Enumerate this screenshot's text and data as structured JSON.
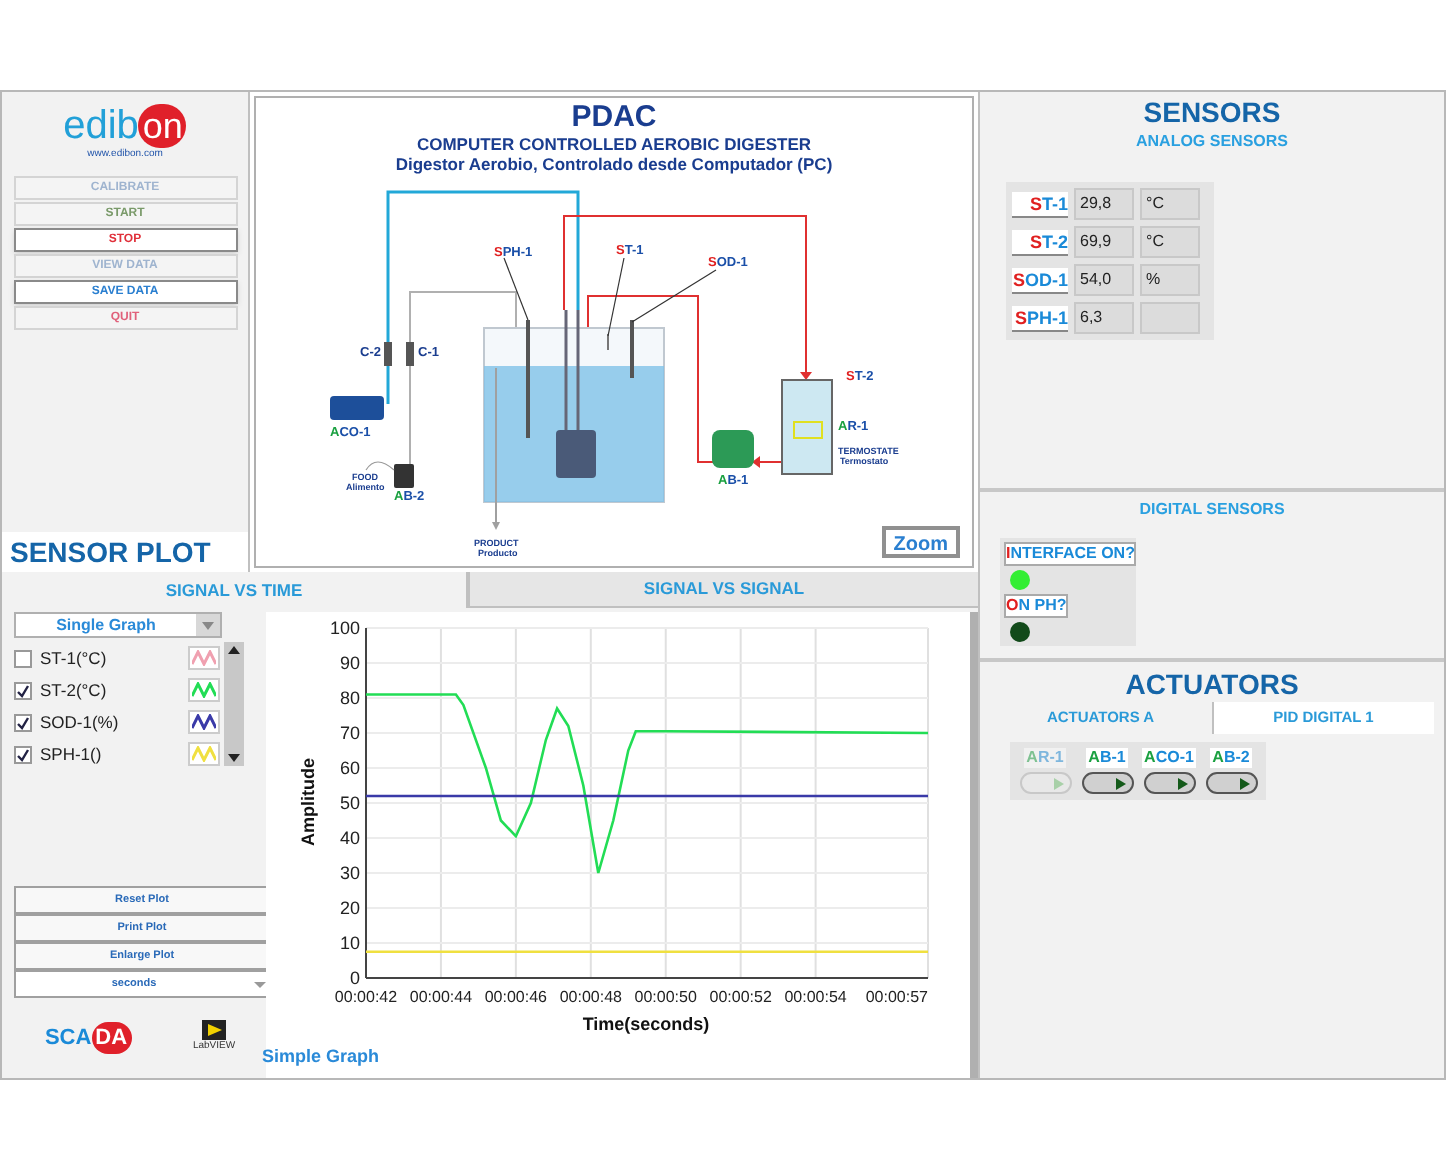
{
  "sidebar": {
    "logo": {
      "part_a": "edib",
      "part_b": "on",
      "url": "www.edibon.com"
    },
    "buttons": [
      {
        "label": "CALIBRATE",
        "color": "#9fb4cf",
        "disabled": true
      },
      {
        "label": "START",
        "color": "#7a9a6a",
        "disabled": true
      },
      {
        "label": "STOP",
        "color": "#e0303a",
        "disabled": false
      },
      {
        "label": "VIEW DATA",
        "color": "#9fb4cf",
        "disabled": true
      },
      {
        "label": "SAVE DATA",
        "color": "#2a7fd0",
        "disabled": false
      },
      {
        "label": "QUIT",
        "color": "#e0607a",
        "disabled": true
      }
    ],
    "section_title": "SENSOR PLOT"
  },
  "diagram": {
    "title": "PDAC",
    "subtitle": "COMPUTER CONTROLLED AEROBIC DIGESTER",
    "subtitle_es": "Digestor Aerobio, Controlado desde Computador (PC)",
    "labels": [
      {
        "text": "SPH-1",
        "kind": "sensor"
      },
      {
        "text": "ST-1",
        "kind": "sensor"
      },
      {
        "text": "SOD-1",
        "kind": "sensor"
      },
      {
        "text": "C-2",
        "kind": "plain"
      },
      {
        "text": "C-1",
        "kind": "plain"
      },
      {
        "text": "ACO-1",
        "kind": "actuator"
      },
      {
        "text": "FOOD",
        "kind": "small"
      },
      {
        "text": "Alimento",
        "kind": "small"
      },
      {
        "text": "AB-2",
        "kind": "actuator"
      },
      {
        "text": "PRODUCT",
        "kind": "small"
      },
      {
        "text": "Producto",
        "kind": "small"
      },
      {
        "text": "AB-1",
        "kind": "actuator"
      },
      {
        "text": "ST-2",
        "kind": "sensor"
      },
      {
        "text": "AR-1",
        "kind": "actuator"
      },
      {
        "text": "TERMOSTATE",
        "kind": "small"
      },
      {
        "text": "Termostato",
        "kind": "small"
      }
    ],
    "zoom_button": "Zoom"
  },
  "plot": {
    "tabs": [
      {
        "label": "SIGNAL VS TIME",
        "selected": true
      },
      {
        "label": "SIGNAL VS SIGNAL",
        "selected": false
      }
    ],
    "mode_select": "Single Graph",
    "legend": [
      {
        "label": "ST-1(°C)",
        "checked": false,
        "color": "#f0a0b0"
      },
      {
        "label": "ST-2(°C)",
        "checked": true,
        "color": "#22dd55"
      },
      {
        "label": "SOD-1(%)",
        "checked": true,
        "color": "#3a3aa8"
      },
      {
        "label": "SPH-1()",
        "checked": true,
        "color": "#f0e040"
      }
    ],
    "buttons": [
      "Reset Plot",
      "Print Plot",
      "Enlarge Plot"
    ],
    "time_unit": "seconds",
    "scada_logo": {
      "part_a": "SCA",
      "part_b": "DA"
    },
    "powered_by": "LabVIEW",
    "graph_name": "Simple Graph",
    "chart_data": {
      "type": "line",
      "xlabel": "Time(seconds)",
      "ylabel": "Amplitude",
      "x": [
        42,
        44.4,
        44.6,
        45.2,
        45.6,
        46,
        46.4,
        46.8,
        47.1,
        47.4,
        47.8,
        48.2,
        48.6,
        49,
        49.2,
        50,
        57
      ],
      "series": [
        {
          "color": "#22dd55",
          "values": [
            81,
            81,
            78,
            60,
            45,
            40.5,
            50,
            68,
            77,
            72,
            55,
            30,
            45,
            65,
            70.5,
            70.5,
            70
          ]
        },
        {
          "color": "#3a3aa8",
          "values": [
            52,
            52,
            52,
            52,
            52,
            52,
            52,
            52,
            52,
            52,
            52,
            52,
            52,
            52,
            52,
            52,
            52
          ]
        },
        {
          "color": "#f0e040",
          "values": [
            7.5,
            7.5,
            7.5,
            7.5,
            7.5,
            7.5,
            7.5,
            7.5,
            7.5,
            7.5,
            7.5,
            7.5,
            7.5,
            7.5,
            7.5,
            7.5,
            7.5
          ]
        }
      ],
      "grid": true,
      "xlim": [
        42,
        57
      ],
      "ylim": [
        0,
        100
      ],
      "xticks": [
        {
          "value": 42,
          "label": "00:00:42"
        },
        {
          "value": 44,
          "label": "00:00:44"
        },
        {
          "value": 46,
          "label": "00:00:46"
        },
        {
          "value": 48,
          "label": "00:00:48"
        },
        {
          "value": 50,
          "label": "00:00:50"
        },
        {
          "value": 52,
          "label": "00:00:52"
        },
        {
          "value": 54,
          "label": "00:00:54"
        },
        {
          "value": 57,
          "label": "00:00:57"
        }
      ],
      "yticks": [
        0,
        10,
        20,
        30,
        40,
        50,
        60,
        70,
        80,
        90,
        100
      ]
    }
  },
  "sensors": {
    "title": "SENSORS",
    "analog_title": "ANALOG SENSORS",
    "analog": [
      {
        "name": "ST-1",
        "value": "29,8",
        "unit": "°C"
      },
      {
        "name": "ST-2",
        "value": "69,9",
        "unit": "°C"
      },
      {
        "name": "SOD-1",
        "value": "54,0",
        "unit": "%"
      },
      {
        "name": "SPH-1",
        "value": "6,3"
      }
    ],
    "digital_title": "DIGITAL SENSORS",
    "digital": [
      {
        "name": "INTERFACE ON?",
        "on": true
      },
      {
        "name": "ON PH?",
        "on": false
      }
    ]
  },
  "actuators": {
    "title": "ACTUATORS",
    "tabs": [
      {
        "label": "ACTUATORS A",
        "selected": true
      },
      {
        "label": "PID DIGITAL 1",
        "selected": false
      }
    ],
    "items": [
      {
        "name": "AR-1",
        "disabled": true,
        "on": false
      },
      {
        "name": "AB-1",
        "disabled": false,
        "on": false
      },
      {
        "name": "ACO-1",
        "disabled": false,
        "on": false
      },
      {
        "name": "AB-2",
        "disabled": false,
        "on": false
      }
    ]
  }
}
